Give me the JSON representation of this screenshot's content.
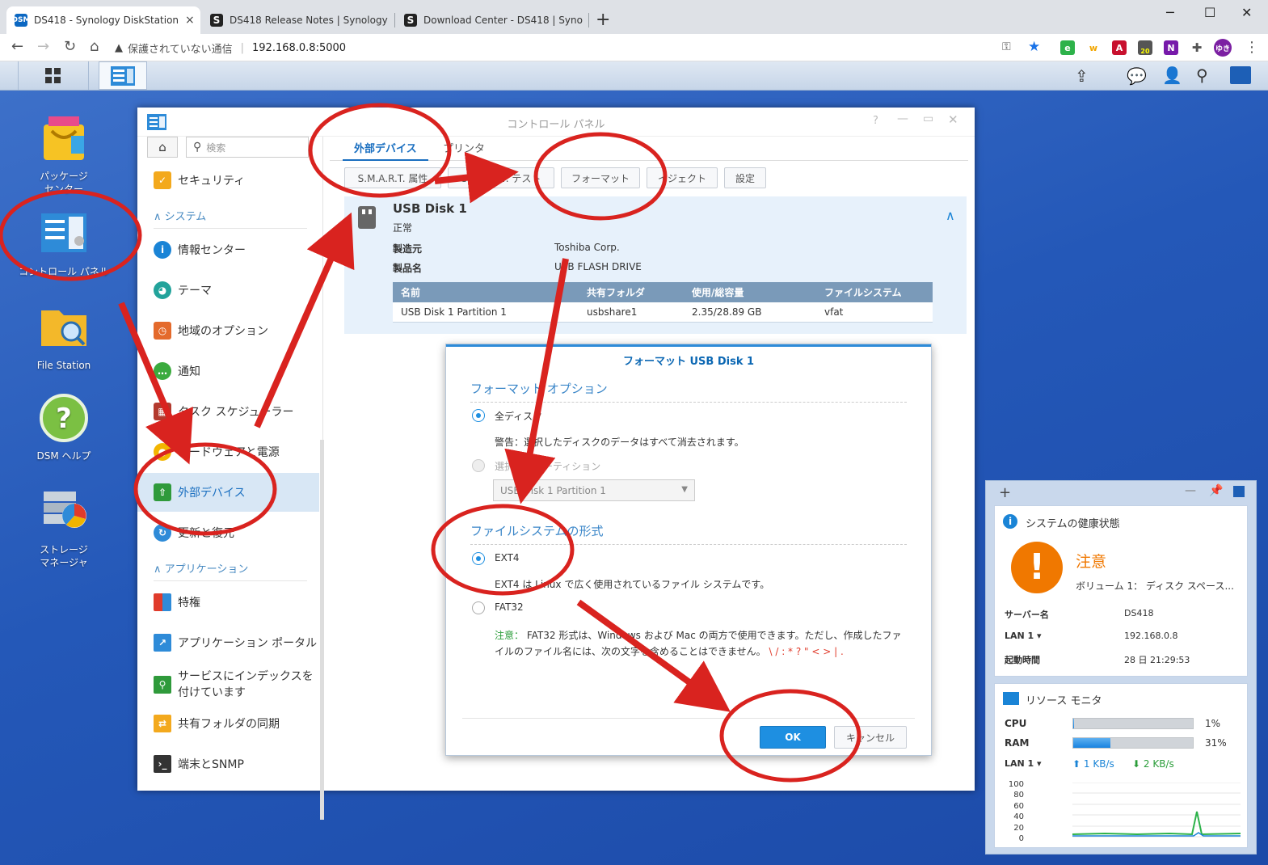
{
  "browser": {
    "tabs": [
      {
        "title": "DS418 - Synology DiskStation",
        "favicon": "dsm-icon"
      },
      {
        "title": "DS418 Release Notes | Synology",
        "favicon": "synology-s-icon"
      },
      {
        "title": "Download Center - DS418 | Syno",
        "favicon": "synology-s-icon"
      }
    ],
    "address": {
      "insecure_label": "保護されていない通信",
      "url": "192.168.0.8:5000"
    },
    "profile_label": "ゆき",
    "ext_badge": "20"
  },
  "desktop": {
    "icons": [
      {
        "label": "パッケージ\nセンター"
      },
      {
        "label": "コントロール パネル"
      },
      {
        "label": "File Station"
      },
      {
        "label": "DSM ヘルプ"
      },
      {
        "label": "ストレージ\nマネージャ"
      }
    ]
  },
  "control_panel": {
    "title": "コントロール パネル",
    "search_placeholder": "検索",
    "sidebar": {
      "security": "セキュリティ",
      "section_system": "システム",
      "items_system": [
        "情報センター",
        "テーマ",
        "地域のオプション",
        "通知",
        "タスク スケジューラー",
        "ハードウェアと電源",
        "外部デバイス",
        "更新と復元"
      ],
      "section_apps": "アプリケーション",
      "items_apps": [
        "特権",
        "アプリケーション ポータル",
        "サービスにインデックスを付けています",
        "共有フォルダの同期",
        "端末とSNMP"
      ]
    },
    "tabs": [
      "外部デバイス",
      "プリンタ"
    ],
    "toolbar": [
      "S.M.A.R.T. 属性",
      "S.M.A.R.T. テスト",
      "フォーマット",
      "イジェクト",
      "設定"
    ],
    "device": {
      "name": "USB Disk 1",
      "status": "正常",
      "maker_label": "製造元",
      "maker": "Toshiba Corp.",
      "product_label": "製品名",
      "product": "USB FLASH DRIVE",
      "table": {
        "headers": [
          "名前",
          "共有フォルダ",
          "使用/総容量",
          "ファイルシステム"
        ],
        "rows": [
          [
            "USB Disk 1 Partition 1",
            "usbshare1",
            "2.35/28.89 GB",
            "vfat"
          ]
        ]
      }
    }
  },
  "format_dialog": {
    "title": "フォーマット USB Disk 1",
    "options_title": "フォーマット オプション",
    "whole_disk": "全ディスク",
    "warning": "警告：選択したディスクのデータはすべて消去されます。",
    "selected_partition": "選択したパーティション",
    "partition_value": "USB Disk 1 Partition 1",
    "fs_title": "ファイルシステムの形式",
    "ext4": "EXT4",
    "ext4_desc": "EXT4 は Linux で広く使用されているファイル システムです。",
    "fat32": "FAT32",
    "note_label": "注意：",
    "note_text": "FAT32 形式は、Windows および Mac の両方で使用できます。ただし、作成したファ",
    "note_text2": "イルのファイル名には、次の文字を含めることはできません。",
    "note_chars": "\\ / : * ? \" < > | .",
    "ok": "OK",
    "cancel": "キャンセル"
  },
  "widgets": {
    "health": {
      "title": "システムの健康状態",
      "status": "注意",
      "detail": "ボリューム 1： ディスク スペース...",
      "server_label": "サーバー名",
      "server": "DS418",
      "lan_label": "LAN 1 ▾",
      "lan": "192.168.0.8",
      "uptime_label": "起動時間",
      "uptime": "28 日 21:29:53"
    },
    "resource": {
      "title": "リソース モニタ",
      "cpu_label": "CPU",
      "cpu": "1%",
      "cpu_value": 0.01,
      "ram_label": "RAM",
      "ram": "31%",
      "ram_value": 0.31,
      "lan_label": "LAN 1 ▾",
      "up": "1 KB/s",
      "down": "2 KB/s",
      "yticks": [
        "100",
        "80",
        "60",
        "40",
        "20",
        "0"
      ]
    }
  },
  "colors": {
    "accent": "#1e8fe1",
    "annotation": "#d9231f",
    "desktop": "#2458b8",
    "warn": "#f07800"
  }
}
